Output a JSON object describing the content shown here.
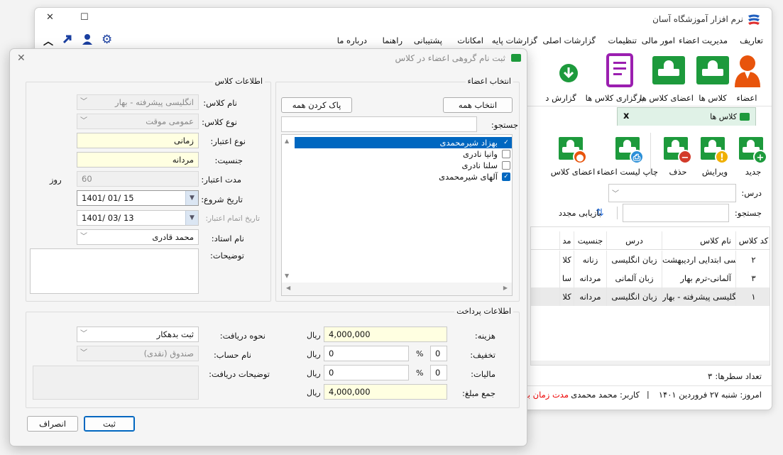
{
  "app": {
    "title": "نرم افزار آموزشگاه آسان"
  },
  "window_controls": {
    "minimize": "—",
    "maximize": "☐",
    "close": "✕"
  },
  "menu": [
    "تعاریف",
    "مدیریت اعضاء",
    "امور مالی",
    "تنظیمات",
    "گزارشات اصلی",
    "گزارشات پایه",
    "امکانات",
    "پشتیبانی",
    "راهنما",
    "درباره ما"
  ],
  "ribbon": {
    "members": "اعضاء",
    "classes": "کلاس ها",
    "class_members": "اعضای کلاس ها",
    "hold_classes": "برگزاری کلاس ها",
    "reports": "گزارش د"
  },
  "tab": {
    "label": "کلاس ها",
    "close": "x"
  },
  "class_toolbar": {
    "new": "جدید",
    "edit": "ویرایش",
    "delete": "حذف",
    "print_members": "چاپ لیست اعضاء",
    "class_members": "اعضای کلاس"
  },
  "filters": {
    "lesson_label": "درس:",
    "search_label": "جستجو:",
    "refresh": "بازیابی مجدد"
  },
  "grid": {
    "headers": [
      "کد کلاس",
      "نام کلاس",
      "درس",
      "جنسیت",
      "مد"
    ],
    "rows": [
      [
        "۲",
        "انگلیسی ابتدایی اردیبهشت",
        "زبان انگلیسی",
        "زنانه",
        "کلا"
      ],
      [
        "۳",
        "آلمانی-ترم بهار",
        "زبان آلمانی",
        "مردانه",
        "سا"
      ],
      [
        "۱",
        "انگلیسی پیشرفته - بهار",
        "زبان انگلیسی",
        "مردانه",
        "کلا"
      ]
    ]
  },
  "status": {
    "row_count_label": "تعداد سطرها:",
    "row_count": "۳",
    "today": "امروز: شنبه ۲۷ فروردین ۱۴۰۱",
    "separator": "|",
    "user": "کاربر: محمد محمدی",
    "expiry": "مدت زمان باق"
  },
  "dialog": {
    "title": "ثبت نام گروهی اعضاء در کلاس",
    "close": "✕",
    "member_select": {
      "title": "انتخاب اعضاء",
      "select_all": "انتخاب همه",
      "clear_all": "پاک کردن همه",
      "search_label": "جستجو:",
      "search_value": "",
      "members": [
        {
          "name": "بهزاد شیرمحمدی",
          "checked": true,
          "selected": true
        },
        {
          "name": "وانیا نادری",
          "checked": false,
          "selected": false
        },
        {
          "name": "سلنا نادری",
          "checked": false,
          "selected": false
        },
        {
          "name": "آلهای شیرمحمدی",
          "checked": true,
          "selected": false
        }
      ]
    },
    "class_info": {
      "title": "اطلاعات کلاس",
      "class_name_label": "نام کلاس:",
      "class_name": "انگلیسی پیشرفته - بهار",
      "class_type_label": "نوع کلاس:",
      "class_type": "عمومی موقت",
      "validity_type_label": "نوع اعتبار:",
      "validity_type": "زمانی",
      "gender_label": "جنسیت:",
      "gender": "مردانه",
      "duration_label": "مدت اعتبار:",
      "duration": "60",
      "duration_unit": "روز",
      "start_date_label": "تاریخ شروع:",
      "start_date": "1401/ 01/ 15",
      "end_date_label": "تاریخ اتمام اعتبار:",
      "end_date": "1401/ 03/ 13",
      "teacher_label": "نام استاد:",
      "teacher": "محمد قادری",
      "notes_label": "توضیحات:",
      "notes": ""
    },
    "payment": {
      "title": "اطلاعات پرداخت",
      "cost_label": "هزینه:",
      "cost": "4,000,000",
      "currency": "ریال",
      "discount_label": "تخفیف:",
      "discount_pct": "0",
      "discount_amount": "0",
      "tax_label": "مالیات:",
      "tax_pct": "0",
      "tax_amount": "0",
      "total_label": "جمع مبلغ:",
      "total": "4,000,000",
      "percent": "%",
      "method_label": "نحوه دریافت:",
      "method": "ثبت بدهکار",
      "account_label": "نام حساب:",
      "account": "صندوق (نقدی)",
      "receipt_notes_label": "توضیحات دریافت:",
      "receipt_notes": ""
    },
    "buttons": {
      "submit": "ثبت",
      "cancel": "انصراف"
    }
  },
  "colors": {
    "accent": "#0067c0",
    "green": "#1d9a3c",
    "purple": "#9b1fb0",
    "highlight_yellow": "#ffffe1"
  }
}
